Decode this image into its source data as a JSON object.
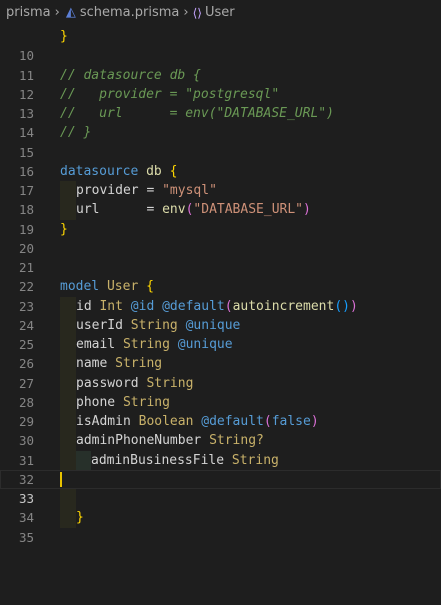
{
  "breadcrumb": {
    "folder": "prisma",
    "file": "schema.prisma",
    "symbol": "User"
  },
  "colors": {
    "background": "#1e1e1e",
    "keyword": "#569cd6",
    "comment": "#6a9955",
    "string": "#ce9178",
    "type": "#c9b26a",
    "brace": "#ffd700",
    "cursor": "#e8c200"
  },
  "lines": [
    {
      "n": "10"
    },
    {
      "n": "11"
    },
    {
      "n": "12"
    },
    {
      "n": "13"
    },
    {
      "n": "14"
    },
    {
      "n": "15"
    },
    {
      "n": "16"
    },
    {
      "n": "17"
    },
    {
      "n": "18"
    },
    {
      "n": "19"
    },
    {
      "n": "20"
    },
    {
      "n": "21"
    },
    {
      "n": "22"
    },
    {
      "n": "23"
    },
    {
      "n": "24"
    },
    {
      "n": "25"
    },
    {
      "n": "26"
    },
    {
      "n": "27"
    },
    {
      "n": "28"
    },
    {
      "n": "29"
    },
    {
      "n": "30"
    },
    {
      "n": "31"
    },
    {
      "n": "32"
    },
    {
      "n": "33"
    },
    {
      "n": "34"
    },
    {
      "n": "35"
    }
  ],
  "code": {
    "l10_brace": "}",
    "l12": "// datasource db {",
    "l13": "//   provider = \"postgresql\"",
    "l14": "//   url      = env(\"DATABASE_URL\")",
    "l15": "// }",
    "l17_kw": "datasource",
    "l17_name": "db",
    "l17_brace": "{",
    "l18_prop": "provider",
    "l18_eq": " = ",
    "l18_val": "\"mysql\"",
    "l19_prop": "url",
    "l19_eq": "      = ",
    "l19_fn": "env",
    "l19_open": "(",
    "l19_arg": "\"DATABASE_URL\"",
    "l19_close": ")",
    "l20_brace": "}",
    "l23_kw": "model",
    "l23_name": "User",
    "l23_brace": "{",
    "l24_field": "id",
    "l24_type": "Int",
    "l24_attr1": "@id",
    "l24_attr2": "@default",
    "l24_p1": "(",
    "l24_fn": "autoincrement",
    "l24_p2": "()",
    "l24_p3": ")",
    "l25_field": "userId",
    "l25_type": "String",
    "l25_attr": "@unique",
    "l26_field": "email",
    "l26_type": "String",
    "l26_attr": "@unique",
    "l27_field": "name",
    "l27_type": "String",
    "l28_field": "password",
    "l28_type": "String",
    "l29_field": "phone",
    "l29_type": "String",
    "l30_field": "isAdmin",
    "l30_type": "Boolean",
    "l30_attr": "@default",
    "l30_p1": "(",
    "l30_val": "false",
    "l30_p2": ")",
    "l31_field": "adminPhoneNumber",
    "l31_type": "String?",
    "l32_field": "adminBusinessFile",
    "l32_type": "String",
    "l35_brace": "}"
  }
}
